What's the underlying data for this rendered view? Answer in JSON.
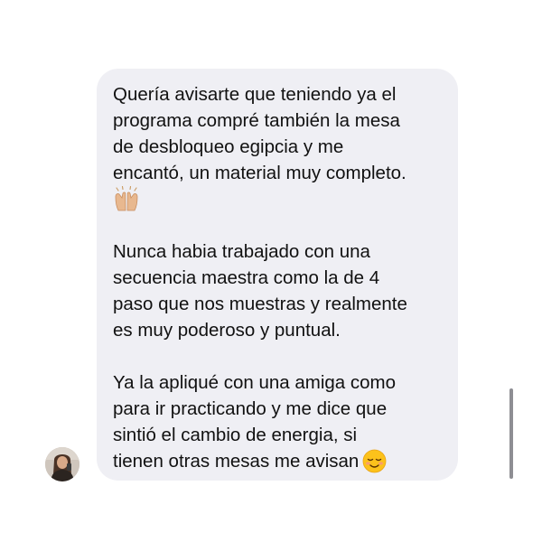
{
  "message": {
    "paragraph_1": "Quería avisarte que teniendo ya el\nprograma compré también la mesa\nde desbloqueo egipcia y me\nencantó, un material muy completo.",
    "paragraph_1_emoji": "raising-hands-emoji",
    "paragraph_2": "Nunca habia trabajado con una\nsecuencia maestra como la de 4\npaso que nos muestras y realmente\nes muy poderoso y puntual.",
    "paragraph_3": "Ya la apliqué con una amiga como\npara ir practicando y me dice que\nsintió el cambio de energia, si\ntienen otras mesas me avisan",
    "paragraph_3_emoji": "smiling-face-emoji"
  },
  "sender": {
    "avatar_icon": "profile-avatar"
  },
  "colors": {
    "bubble_background": "#efeff4",
    "text": "#111111",
    "page_background": "#ffffff",
    "scrollbar": "#8e8e93"
  }
}
